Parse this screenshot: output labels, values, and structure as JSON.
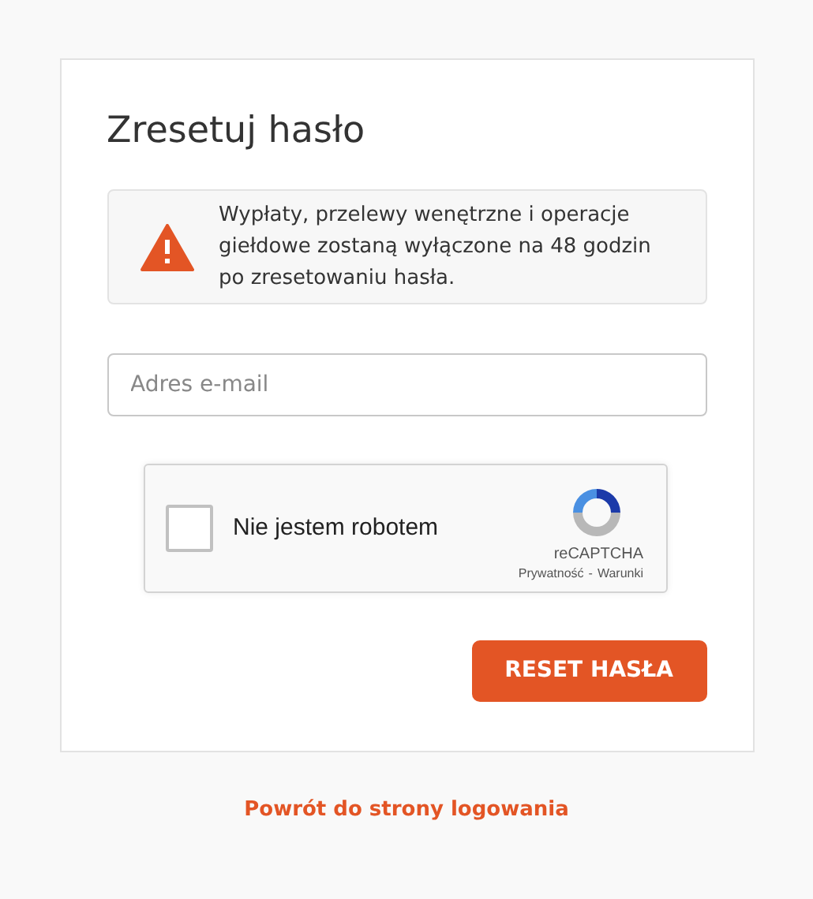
{
  "title": "Zresetuj hasło",
  "alert": {
    "text": "Wypłaty, przelewy wenętrzne i operacje giełdowe zostaną wyłączone na 48 godzin po zresetowaniu hasła."
  },
  "email": {
    "placeholder": "Adres e-mail"
  },
  "captcha": {
    "label": "Nie jestem robotem",
    "checked": false,
    "brand": "reCAPTCHA",
    "privacy": "Prywatność",
    "separator": "-",
    "terms": "Warunki"
  },
  "submit": "RESET HASŁA",
  "back_link": "Powrót do strony logowania"
}
